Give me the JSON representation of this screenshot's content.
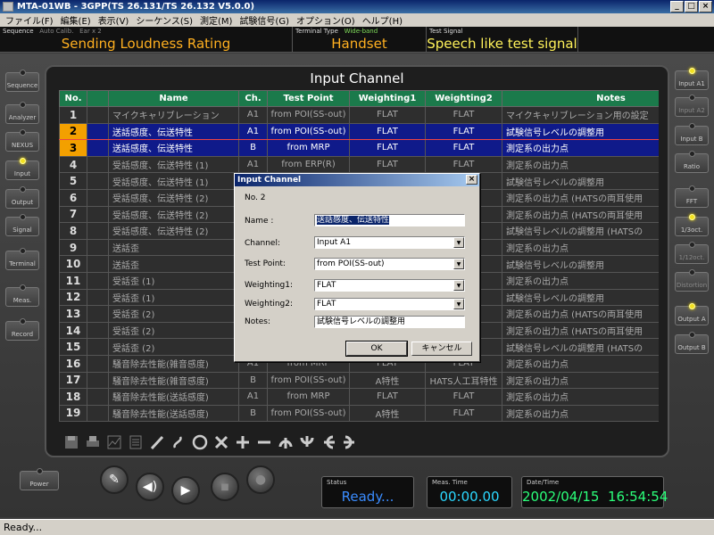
{
  "window": {
    "title": "MTA-01WB - 3GPP(TS 26.131/TS 26.132 V5.0.0)",
    "buttons": [
      "_",
      "□",
      "×"
    ]
  },
  "menu": [
    "ファイル(F)",
    "編集(E)",
    "表示(V)",
    "シーケンス(S)",
    "測定(M)",
    "試験信号(G)",
    "オプション(O)",
    "ヘルプ(H)"
  ],
  "header": {
    "sequence_label": "Sequence",
    "auto_calib_label": "Auto Calib.",
    "ear_label": "Ear x 2",
    "sequence_value": "Sending Loudness Rating",
    "terminal_label": "Terminal Type",
    "terminal_band": "Wide-band",
    "terminal_value": "Handset",
    "signal_label": "Test Signal",
    "signal_value": "Speech like test signal"
  },
  "left_buttons": [
    {
      "label": "Sequence",
      "led": false
    },
    {
      "label": "Analyzer",
      "led": false
    },
    {
      "label": "NEXUS",
      "led": false
    },
    {
      "label": "Input",
      "led": true
    },
    {
      "label": "Output",
      "led": false
    },
    {
      "label": "Signal",
      "led": false
    },
    {
      "label": "Terminal",
      "led": false
    },
    {
      "label": "Meas.",
      "led": false
    },
    {
      "label": "Record",
      "led": false
    }
  ],
  "right_buttons": [
    {
      "label": "Input A1",
      "led": true,
      "dim": false
    },
    {
      "label": "Input A2",
      "led": false,
      "dim": true
    },
    {
      "label": "Input B",
      "led": false,
      "dim": false
    },
    {
      "label": "Ratio",
      "led": false,
      "dim": false
    },
    {
      "label": "FFT",
      "led": false,
      "dim": false
    },
    {
      "label": "1/3oct.",
      "led": true,
      "dim": false
    },
    {
      "label": "1/12oct.",
      "led": false,
      "dim": true
    },
    {
      "label": "Distortion",
      "led": false,
      "dim": true
    },
    {
      "label": "Output A",
      "led": true,
      "dim": false
    },
    {
      "label": "Output B",
      "led": false,
      "dim": false
    }
  ],
  "panel_title": "Input Channel",
  "table": {
    "columns": [
      "No.",
      "",
      "Name",
      "Ch.",
      "Test Point",
      "Weighting1",
      "Weighting2",
      "Notes"
    ],
    "rows": [
      [
        "1",
        "マイクキャリブレーション",
        "A1",
        "from POI(SS-out)",
        "FLAT",
        "FLAT",
        "マイクキャリブレーション用の設定"
      ],
      [
        "2",
        "送話感度、伝送特性",
        "A1",
        "from POI(SS-out)",
        "FLAT",
        "FLAT",
        "試験信号レベルの調整用"
      ],
      [
        "3",
        "送話感度、伝送特性",
        "B",
        "from MRP",
        "FLAT",
        "FLAT",
        "測定系の出力点"
      ],
      [
        "4",
        "受話感度、伝送特性 (1)",
        "A1",
        "from ERP(R)",
        "FLAT",
        "FLAT",
        "測定系の出力点"
      ],
      [
        "5",
        "受話感度、伝送特性 (1)",
        "",
        "",
        "",
        "FLAT",
        "試験信号レベルの調整用"
      ],
      [
        "6",
        "受話感度、伝送特性 (2)",
        "",
        "",
        "",
        "FLAT",
        "測定系の出力点 (HATSの両耳使用"
      ],
      [
        "7",
        "受話感度、伝送特性 (2)",
        "",
        "",
        "",
        "FLAT",
        "測定系の出力点 (HATSの両耳使用"
      ],
      [
        "8",
        "受話感度、伝送特性 (2)",
        "",
        "",
        "",
        "FLAT",
        "試験信号レベルの調整用 (HATSの"
      ],
      [
        "9",
        "送話歪",
        "",
        "",
        "",
        "FLAT",
        "測定系の出力点"
      ],
      [
        "10",
        "送話歪",
        "",
        "",
        "",
        "FLAT",
        "試験信号レベルの調整用"
      ],
      [
        "11",
        "受話歪 (1)",
        "",
        "",
        "",
        "C特性",
        "測定系の出力点"
      ],
      [
        "12",
        "受話歪 (1)",
        "",
        "",
        "",
        "FLAT",
        "試験信号レベルの調整用"
      ],
      [
        "13",
        "受話歪 (2)",
        "",
        "",
        "",
        "C特性",
        "測定系の出力点 (HATSの両耳使用"
      ],
      [
        "14",
        "受話歪 (2)",
        "",
        "",
        "",
        "C特性",
        "測定系の出力点 (HATSの両耳使用"
      ],
      [
        "15",
        "受話歪 (2)",
        "",
        "",
        "",
        "FLAT",
        "試験信号レベルの調整用 (HATSの"
      ],
      [
        "16",
        "騒音除去性能(雑音感度)",
        "A1",
        "from MRP",
        "FLAT",
        "FLAT",
        "測定系の出力点"
      ],
      [
        "17",
        "騒音除去性能(雑音感度)",
        "B",
        "from POI(SS-out)",
        "A特性",
        "HATS人工耳特性",
        "測定系の出力点"
      ],
      [
        "18",
        "騒音除去性能(送話感度)",
        "A1",
        "from MRP",
        "FLAT",
        "FLAT",
        "測定系の出力点"
      ],
      [
        "19",
        "騒音除去性能(送話感度)",
        "B",
        "from POI(SS-out)",
        "A特性",
        "FLAT",
        "測定系の出力点"
      ]
    ]
  },
  "dialog": {
    "title": "Input Channel",
    "close": "×",
    "no_label": "No. 2",
    "name_label": "Name :",
    "name_value": "送話感度、伝送特性",
    "channel_label": "Channel:",
    "channel_value": "Input A1",
    "testpoint_label": "Test Point:",
    "testpoint_value": "from POI(SS-out)",
    "weighting1_label": "Weighting1:",
    "weighting1_value": "FLAT",
    "weighting2_label": "Weighting2:",
    "weighting2_value": "FLAT",
    "notes_label": "Notes:",
    "notes_value": "試験信号レベルの調整用",
    "ok": "OK",
    "cancel": "キャンセル"
  },
  "toolbar_icons": [
    "save-icon",
    "print-icon",
    "graph-icon",
    "list-icon",
    "pen-icon",
    "curve-icon",
    "circle-icon",
    "cross-icon",
    "plus-icon",
    "minus-icon",
    "arrow-up-icon",
    "arrow-down-icon",
    "arrow-left-icon",
    "arrow-right-icon"
  ],
  "bottom": {
    "power_label": "Power",
    "status_label": "Status",
    "status_value": "Ready...",
    "meas_time_label": "Meas. Time",
    "meas_time_value": "00:00.00",
    "datetime_label": "Date/Time",
    "datetime_value": "2002/04/15  16:54:54"
  },
  "statusbar": "Ready...",
  "colors": {
    "accent_orange": "#ffb020",
    "selection_blue": "#0f1a8a",
    "header_green": "#1b7a4b",
    "led_yellow": "#f3e11f",
    "status_blue": "#3a8cff",
    "time_cyan": "#2bd8ff",
    "date_green": "#2bff7a"
  }
}
